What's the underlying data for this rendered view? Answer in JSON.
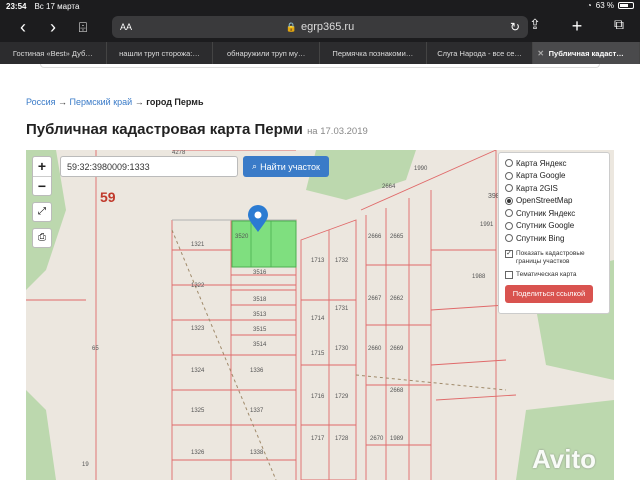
{
  "status": {
    "time": "23:54",
    "date": "Вс 17 марта",
    "battery": "63 %"
  },
  "browser": {
    "url": "egrp365.ru",
    "aa": "AA",
    "tabs": [
      {
        "label": "Гостиная «Best» Дуб…"
      },
      {
        "label": "нашли труп сторожа:…"
      },
      {
        "label": "обнаружили труп му…"
      },
      {
        "label": "Пермячка познакоми…"
      },
      {
        "label": "Слуга Народа - все се…"
      },
      {
        "label": "Публичная кадаст…",
        "active": true
      }
    ]
  },
  "breadcrumb": {
    "item1": "Россия",
    "sep": "→",
    "item2": "Пермский край",
    "item3": "город Пермь"
  },
  "page": {
    "title": "Публичная кадастровая карта Перми",
    "date": "на 17.03.2019"
  },
  "map": {
    "zoom_in": "+",
    "zoom_out": "−",
    "search_value": "59:32:3980009:1333",
    "find_button": "Найти участок",
    "layers": [
      {
        "label": "Карта Яндекс",
        "selected": false
      },
      {
        "label": "Карта Google",
        "selected": false
      },
      {
        "label": "Карта 2GIS",
        "selected": false
      },
      {
        "label": "OpenStreetMap",
        "selected": true
      },
      {
        "label": "Спутник Яндекс",
        "selected": false
      },
      {
        "label": "Спутник Google",
        "selected": false
      },
      {
        "label": "Спутник Bing",
        "selected": false
      }
    ],
    "check_cadastral": "Показать кадастровые границы участков",
    "check_thematic": "Тематическая карта",
    "share_button": "Поделиться ссылкой",
    "labels": {
      "l59": "59",
      "l4278": "4278",
      "l1321": "1321",
      "l1322": "1322",
      "l1323": "1323",
      "l1324": "1324",
      "l1325": "1325",
      "l1326": "1326",
      "l1336": "1336",
      "l1337": "1337",
      "l1338": "1338",
      "l3516": "3516",
      "l3520": "3520",
      "l3518": "3518",
      "l3513": "3513",
      "l3515": "3515",
      "l3514": "3514",
      "l1713": "1713",
      "l1732": "1732",
      "l1714": "1714",
      "l1731": "1731",
      "l1715": "1715",
      "l1730": "1730",
      "l1716": "1716",
      "l1729": "1729",
      "l1717": "1717",
      "l1728": "1728",
      "l2664": "2664",
      "l1990": "1990",
      "l1991": "1991",
      "l2666": "2666",
      "l2665": "2665",
      "l2667": "2667",
      "l2662": "2662",
      "l2660": "2660",
      "l2669": "2669",
      "l2668": "2668",
      "l2670": "2670",
      "l1988": "1988",
      "l1989": "1989",
      "l398": "398",
      "l65": "65",
      "l19": "19"
    }
  },
  "watermark": "Avito"
}
